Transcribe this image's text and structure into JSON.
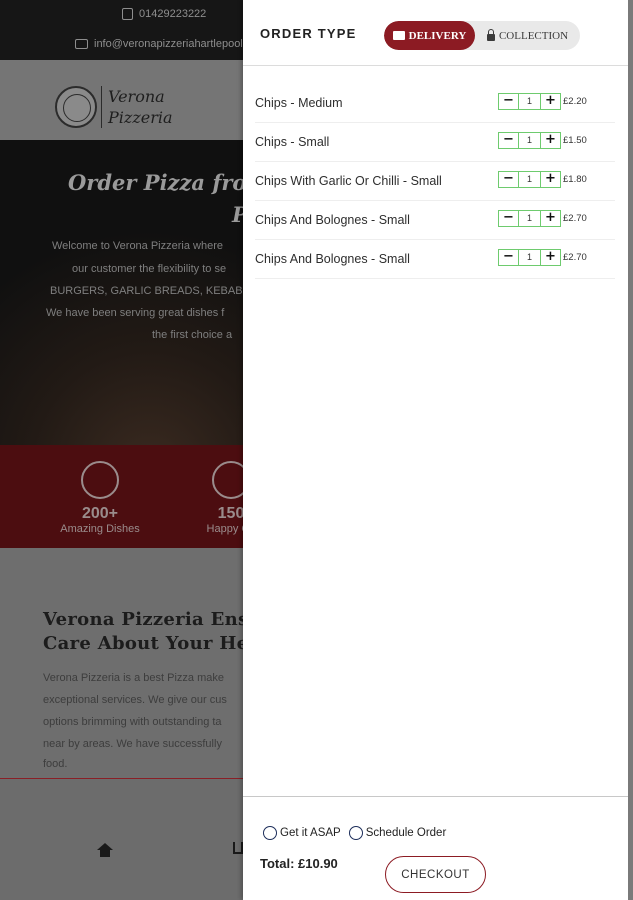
{
  "background": {
    "phone": "01429223222",
    "email": "info@veronapizzeriahartlepool.",
    "logo_line1": "Verona",
    "logo_line2": "Pizzeria",
    "hero_title_line1": "Order Pizza from",
    "hero_title_line2": "P",
    "hero_lines": [
      "Welcome to Verona Pizzeria where",
      "our customer the flexibility to se",
      "BURGERS, GARLIC BREADS, KEBAB",
      "We have been serving great dishes f",
      "the first choice a"
    ],
    "stats": [
      {
        "number": "200+",
        "label": "Amazing Dishes"
      },
      {
        "number": "150",
        "label": "Happy Cu"
      }
    ],
    "about_heading_line1": "Verona Pizzeria Ensu",
    "about_heading_line2": "Care About Your Hea",
    "about_lines": [
      "Verona Pizzeria is a best Pizza make",
      "exceptional services. We give our cus",
      "options brimming with outstanding ta",
      "near by areas. We have successfully",
      "food."
    ]
  },
  "order_panel": {
    "title": "ORDER TYPE",
    "delivery_label": "DELIVERY",
    "collection_label": "COLLECTION",
    "items": [
      {
        "name": "Chips - Medium",
        "qty": "1",
        "price": "£2.20"
      },
      {
        "name": "Chips - Small",
        "qty": "1",
        "price": "£1.50"
      },
      {
        "name": "Chips With Garlic Or Chilli - Small",
        "qty": "1",
        "price": "£1.80"
      },
      {
        "name": "Chips And Bolognes - Small",
        "qty": "1",
        "price": "£2.70"
      },
      {
        "name": "Chips And Bolognes - Small",
        "qty": "1",
        "price": "£2.70"
      }
    ],
    "minus_symbol": "−",
    "plus_symbol": "+",
    "option_asap": "Get it ASAP",
    "option_schedule": "Schedule Order",
    "total": "Total: £10.90",
    "checkout_label": "CHECKOUT"
  },
  "colors": {
    "brand": "#8c1b23",
    "stepper_border": "#6ecb6e"
  }
}
